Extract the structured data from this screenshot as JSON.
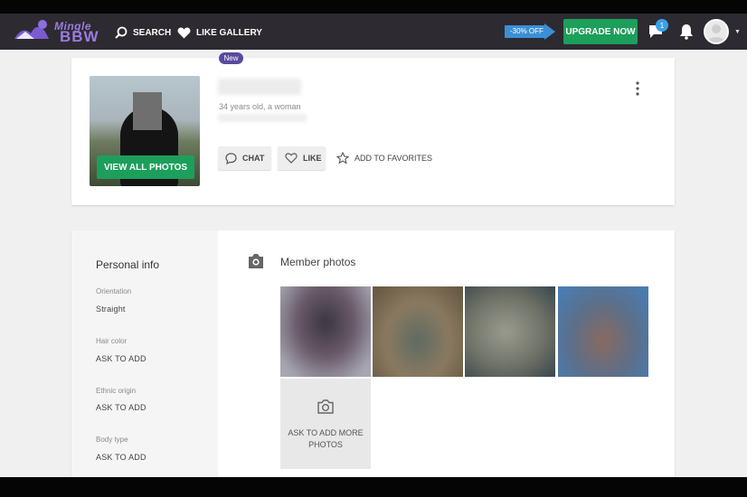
{
  "header": {
    "logo_top": "Mingle",
    "logo_bottom": "BBW",
    "search_label": "SEARCH",
    "gallery_label": "LIKE GALLERY",
    "discount_label": "-30% OFF",
    "upgrade_label": "UPGRADE NOW",
    "messages_badge": "1",
    "accent_color": "#1c9f5a",
    "brand_color": "#9a7be0"
  },
  "profile": {
    "new_badge": "New",
    "age_text": "34 years old, a woman",
    "view_photos_label": "VIEW ALL PHOTOS",
    "chat_label": "CHAT",
    "like_label": "LIKE",
    "favorites_label": "ADD TO FAVORITES"
  },
  "personal_info": {
    "title": "Personal info",
    "fields": [
      {
        "label": "Orientation",
        "value": "Straight"
      },
      {
        "label": "Hair color",
        "value": "ASK TO ADD"
      },
      {
        "label": "Ethnic origin",
        "value": "ASK TO ADD"
      },
      {
        "label": "Body type",
        "value": "ASK TO ADD"
      }
    ]
  },
  "member_photos": {
    "title": "Member photos",
    "ask_more_label": "ASK TO ADD MORE PHOTOS"
  }
}
